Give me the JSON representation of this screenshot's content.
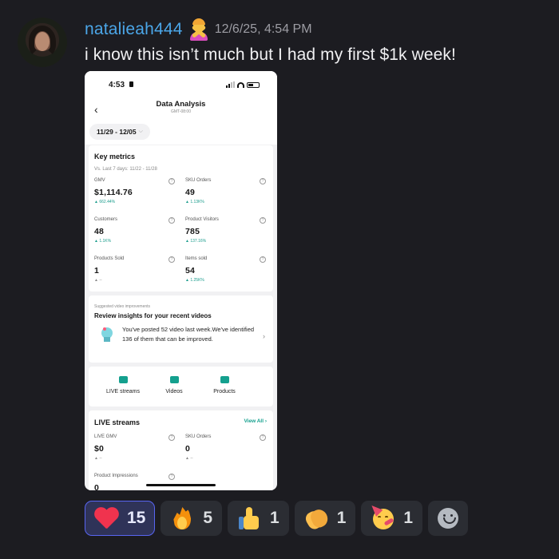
{
  "message": {
    "username": "natalieah444",
    "status_emoji": "woman-gesturing-no-emoji",
    "timestamp": "12/6/25, 4:54 PM",
    "text": "i know this isn’t much but I had my first $1k week!"
  },
  "screenshot": {
    "status_bar": {
      "time": "4:53"
    },
    "nav": {
      "title": "Data Analysis",
      "subtitle": "GMT-08:00",
      "back_icon": "chevron-left-icon"
    },
    "date_range": "11/29 - 12/05",
    "key_metrics": {
      "title": "Key metrics",
      "comparison": "Vs. Last 7 days: 11/22 - 11/28",
      "items": [
        {
          "label": "GMV",
          "value": "$1,114.76",
          "change": "662.44%"
        },
        {
          "label": "SKU Orders",
          "value": "49",
          "change": "1.13K%"
        },
        {
          "label": "Customers",
          "value": "48",
          "change": "1.1K%"
        },
        {
          "label": "Product Visitors",
          "value": "785",
          "change": "137.16%"
        },
        {
          "label": "Products Sold",
          "value": "1",
          "change": "--"
        },
        {
          "label": "Items sold",
          "value": "54",
          "change": "1.25K%"
        }
      ]
    },
    "suggestion": {
      "kicker": "Suggested video improvements",
      "title": "Review insights for your recent videos",
      "body": "You've posted 52 video last week.We've identified 136 of them that can be improved."
    },
    "tabs": [
      {
        "label": "LIVE streams",
        "icon": "live-icon"
      },
      {
        "label": "Videos",
        "icon": "video-icon"
      },
      {
        "label": "Products",
        "icon": "bag-icon"
      }
    ],
    "live": {
      "title": "LIVE streams",
      "view_all": "View All",
      "items": [
        {
          "label": "LIVE GMV",
          "value": "$0",
          "change": "--"
        },
        {
          "label": "SKU Orders",
          "value": "0",
          "change": "--"
        },
        {
          "label": "Product Impressions",
          "value": "0"
        }
      ]
    },
    "accent_color": "#14a08e"
  },
  "reactions": [
    {
      "emoji": "red-heart-icon",
      "count": "15",
      "active": true
    },
    {
      "emoji": "fire-icon",
      "count": "5"
    },
    {
      "emoji": "thumbs-up-icon",
      "count": "1"
    },
    {
      "emoji": "clapping-hands-icon",
      "count": "1"
    },
    {
      "emoji": "partying-face-icon",
      "count": "1"
    }
  ],
  "add_reaction_icon": "smiley-add-reaction-icon"
}
